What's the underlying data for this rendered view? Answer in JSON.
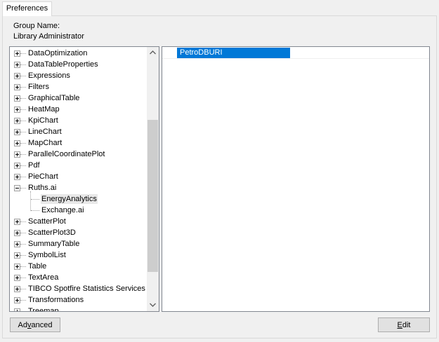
{
  "tabs": [
    {
      "label": "Preferences",
      "active": true
    }
  ],
  "group": {
    "label": "Group Name:",
    "value": "Library Administrator"
  },
  "tree": {
    "items": [
      {
        "label": "DataOptimization",
        "level": 0,
        "expander": "plus"
      },
      {
        "label": "DataTableProperties",
        "level": 0,
        "expander": "plus"
      },
      {
        "label": "Expressions",
        "level": 0,
        "expander": "plus"
      },
      {
        "label": "Filters",
        "level": 0,
        "expander": "plus"
      },
      {
        "label": "GraphicalTable",
        "level": 0,
        "expander": "plus"
      },
      {
        "label": "HeatMap",
        "level": 0,
        "expander": "plus"
      },
      {
        "label": "KpiChart",
        "level": 0,
        "expander": "plus"
      },
      {
        "label": "LineChart",
        "level": 0,
        "expander": "plus"
      },
      {
        "label": "MapChart",
        "level": 0,
        "expander": "plus"
      },
      {
        "label": "ParallelCoordinatePlot",
        "level": 0,
        "expander": "plus"
      },
      {
        "label": "Pdf",
        "level": 0,
        "expander": "plus"
      },
      {
        "label": "PieChart",
        "level": 0,
        "expander": "plus"
      },
      {
        "label": "Ruths.ai",
        "level": 0,
        "expander": "minus"
      },
      {
        "label": "EnergyAnalytics",
        "level": 1,
        "selected": true
      },
      {
        "label": "Exchange.ai",
        "level": 1
      },
      {
        "label": "ScatterPlot",
        "level": 0,
        "expander": "plus"
      },
      {
        "label": "ScatterPlot3D",
        "level": 0,
        "expander": "plus"
      },
      {
        "label": "SummaryTable",
        "level": 0,
        "expander": "plus"
      },
      {
        "label": "SymbolList",
        "level": 0,
        "expander": "plus"
      },
      {
        "label": "Table",
        "level": 0,
        "expander": "plus"
      },
      {
        "label": "TextArea",
        "level": 0,
        "expander": "plus"
      },
      {
        "label": "TIBCO Spotfire Statistics Services",
        "level": 0,
        "expander": "plus"
      },
      {
        "label": "Transformations",
        "level": 0,
        "expander": "plus"
      },
      {
        "label": "Treemap",
        "level": 0,
        "expander": "plus"
      }
    ],
    "scroll_up_icon": "chevron-up-icon",
    "scroll_down_icon": "chevron-down-icon"
  },
  "list": {
    "items": [
      {
        "label": "PetroDBURI",
        "selected": true
      }
    ]
  },
  "buttons": {
    "advanced": {
      "pre": "Ad",
      "mnemonic": "v",
      "post": "anced"
    },
    "edit": {
      "pre": "",
      "mnemonic": "E",
      "post": "dit"
    }
  },
  "colors": {
    "selection": "#0078d7",
    "button_face": "#e1e1e1",
    "window_bg": "#f0f0f0"
  }
}
